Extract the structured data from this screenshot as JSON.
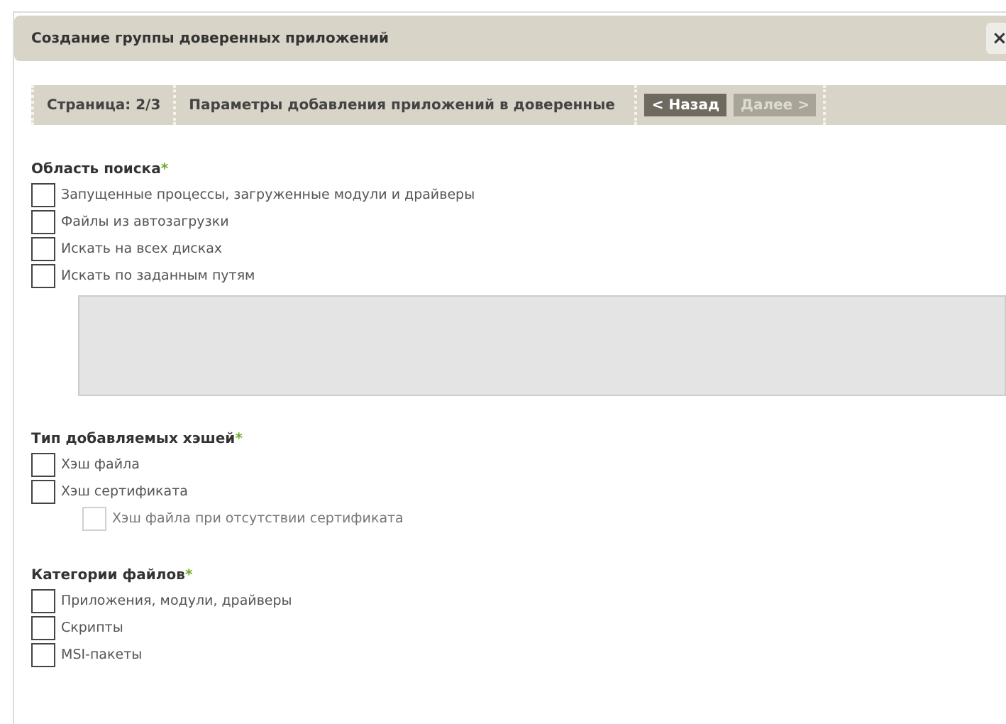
{
  "window": {
    "title": "Создание группы доверенных приложений",
    "close": "×"
  },
  "toolbar": {
    "page": "Страница: 2/3",
    "step": "Параметры добавления приложений в доверенные",
    "buttons": [
      {
        "label": "< Назад",
        "disabled": false
      },
      {
        "label": "Далее >",
        "disabled": true
      }
    ]
  },
  "sections": [
    {
      "title": "Область поиска",
      "required_mark": "*",
      "options": [
        {
          "label": "Запущенные процессы, загруженные модули и драйверы",
          "checked": false,
          "disabled": false
        },
        {
          "label": "Файлы из автозагрузки",
          "checked": false,
          "disabled": false
        },
        {
          "label": "Искать на всех дисках",
          "checked": false,
          "disabled": false
        },
        {
          "label": "Искать по заданным путям",
          "checked": false,
          "disabled": false
        }
      ],
      "paths_field": {
        "disabled": true
      }
    },
    {
      "title": "Тип добавляемых хэшей",
      "required_mark": "*",
      "options": [
        {
          "label": "Хэш файла",
          "checked": false,
          "disabled": false
        },
        {
          "label": "Хэш сертификата",
          "checked": false,
          "disabled": false,
          "children": [
            {
              "label": "Хэш файла при отсутствии сертификата",
              "checked": false,
              "disabled": true
            }
          ]
        }
      ]
    },
    {
      "title": "Категории файлов",
      "required_mark": "*",
      "options": [
        {
          "label": "Приложения, модули, драйверы",
          "checked": false,
          "disabled": false
        },
        {
          "label": "Скрипты",
          "checked": false,
          "disabled": false
        },
        {
          "label": "MSI-пакеты",
          "checked": false,
          "disabled": false
        }
      ]
    }
  ]
}
